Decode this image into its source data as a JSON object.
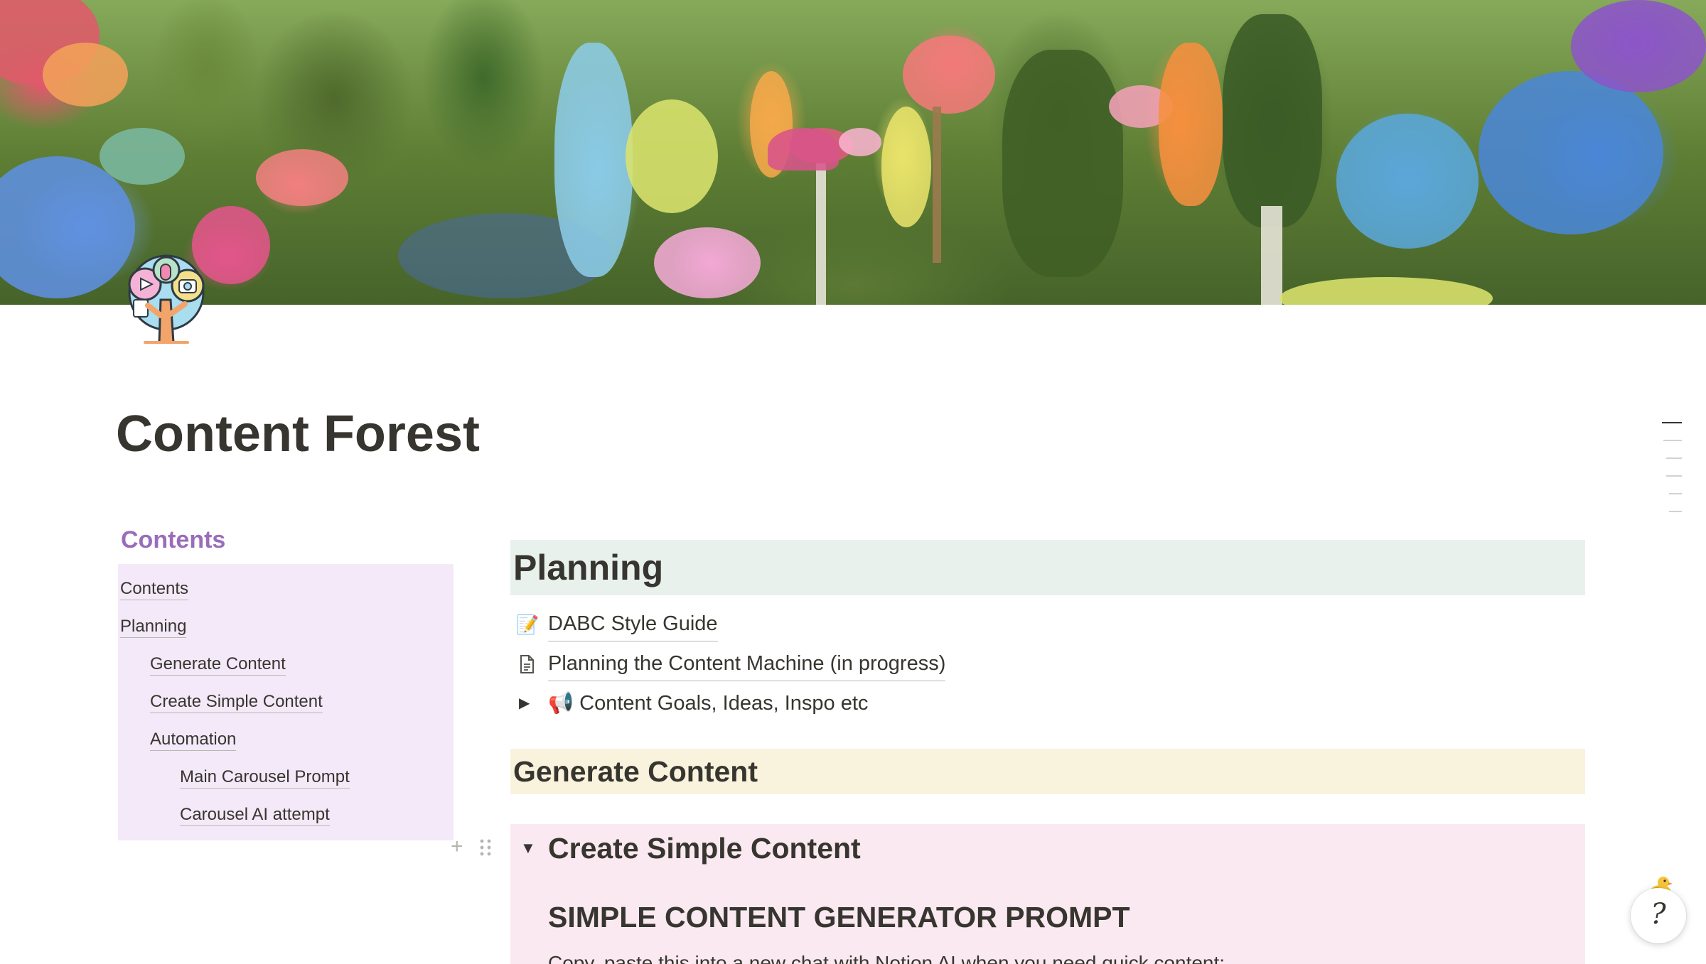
{
  "page": {
    "title": "Content Forest",
    "cover": "fantasy-forest-cover-image",
    "icon": "tree-with-media-icons"
  },
  "toc": {
    "heading": "Contents",
    "items": [
      {
        "label": "Contents",
        "level": 1
      },
      {
        "label": "Planning",
        "level": 1
      },
      {
        "label": "Generate Content",
        "level": 2
      },
      {
        "label": "Create Simple Content",
        "level": 2
      },
      {
        "label": "Automation",
        "level": 2
      },
      {
        "label": "Main Carousel Prompt",
        "level": 3
      },
      {
        "label": "Carousel AI attempt",
        "level": 3
      }
    ]
  },
  "main": {
    "planning_heading": "Planning",
    "planning_links": [
      {
        "icon": "📝",
        "label": "DABC Style Guide"
      },
      {
        "icon": "document-icon",
        "label": "Planning the Content Machine (in progress)"
      }
    ],
    "toggle_item": {
      "icon": "📢",
      "label": "Content Goals, Ideas, Inspo etc"
    },
    "generate_heading": "Generate Content",
    "create_toggle": {
      "label": "Create Simple Content",
      "subheading": "SIMPLE CONTENT GENERATOR PROMPT",
      "paragraph": "Copy, paste this into a new chat with Notion AI when you need quick content:"
    }
  },
  "colors": {
    "toc_heading": "#9a6dbb",
    "toc_bg": "#f3e9f8",
    "planning_bg": "#e9f1ec",
    "generate_bg": "#f9f2dd",
    "create_bg": "#fae9f0"
  },
  "help": {
    "glyph": "?"
  }
}
